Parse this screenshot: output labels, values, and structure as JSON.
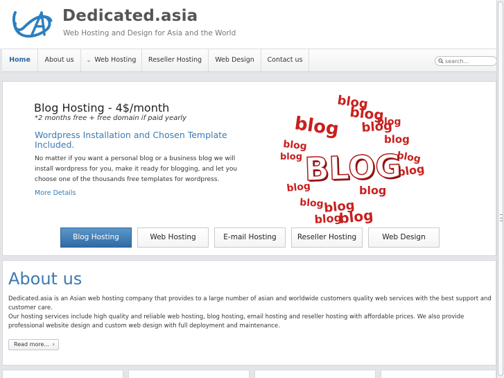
{
  "header": {
    "site_name": "Dedicated.asia",
    "tagline": "Web Hosting and Design for Asia and the World"
  },
  "nav": {
    "items": [
      {
        "label": "Home",
        "active": true
      },
      {
        "label": "About us"
      },
      {
        "label": "Web Hosting",
        "has_dropdown": true
      },
      {
        "label": "Reseller Hosting"
      },
      {
        "label": "Web Design"
      },
      {
        "label": "Contact us"
      }
    ],
    "search_placeholder": "search..."
  },
  "slider": {
    "title": "Blog Hosting - 4$/month",
    "subtitle": "*2 months free + free domain if paid yearly",
    "heading": "Wordpress Installation and Chosen Template Included.",
    "text": "No matter if you want a personal blog or a business blog we will install wordpress for you, make it ready for blogging, and let you choose one of the thousands free templates for wordpress.",
    "link": "More Details",
    "art_word_big": "BLOG",
    "art_word_small": "blog",
    "tabs": [
      {
        "label": "Blog Hosting",
        "active": true
      },
      {
        "label": "Web Hosting"
      },
      {
        "label": "E-mail Hosting"
      },
      {
        "label": "Reseller Hosting"
      },
      {
        "label": "Web Design"
      }
    ]
  },
  "about": {
    "title": "About us",
    "line1": "Dedicated.asia is an Asian web hosting company that provides to a large number of asian and worldwide customers quality web services with the best support and customer care.",
    "line2": "Our hosting services include high quality and reliable web hosting, blog hosting, email hosting and reseller hosting with affordable prices. We also provide professional website design and custom web design with full deployment and maintenance.",
    "read_more": "Read more..."
  },
  "colors": {
    "accent": "#3a7ab3",
    "active_tab": "#2f6aa3",
    "blog_red": "#c8201e"
  }
}
